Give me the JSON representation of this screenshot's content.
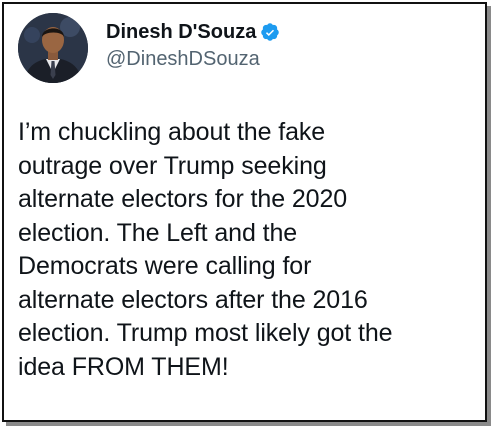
{
  "tweet": {
    "author": {
      "display_name": "Dinesh D'Souza",
      "handle": "@DineshDSouza",
      "verified": true,
      "avatar_icon": "profile-photo",
      "verified_icon": "verified-badge-icon"
    },
    "text": "I’m chuckling about the fake\noutrage over Trump seeking\nalternate electors for the 2020\nelection. The Left and the\nDemocrats were calling for\nalternate electors after the 2016\nelection. Trump most likely got the\nidea FROM THEM!"
  },
  "colors": {
    "verified_blue": "#1d9bf0",
    "text_primary": "#0f1419",
    "text_secondary": "#536471",
    "border": "#111111"
  }
}
